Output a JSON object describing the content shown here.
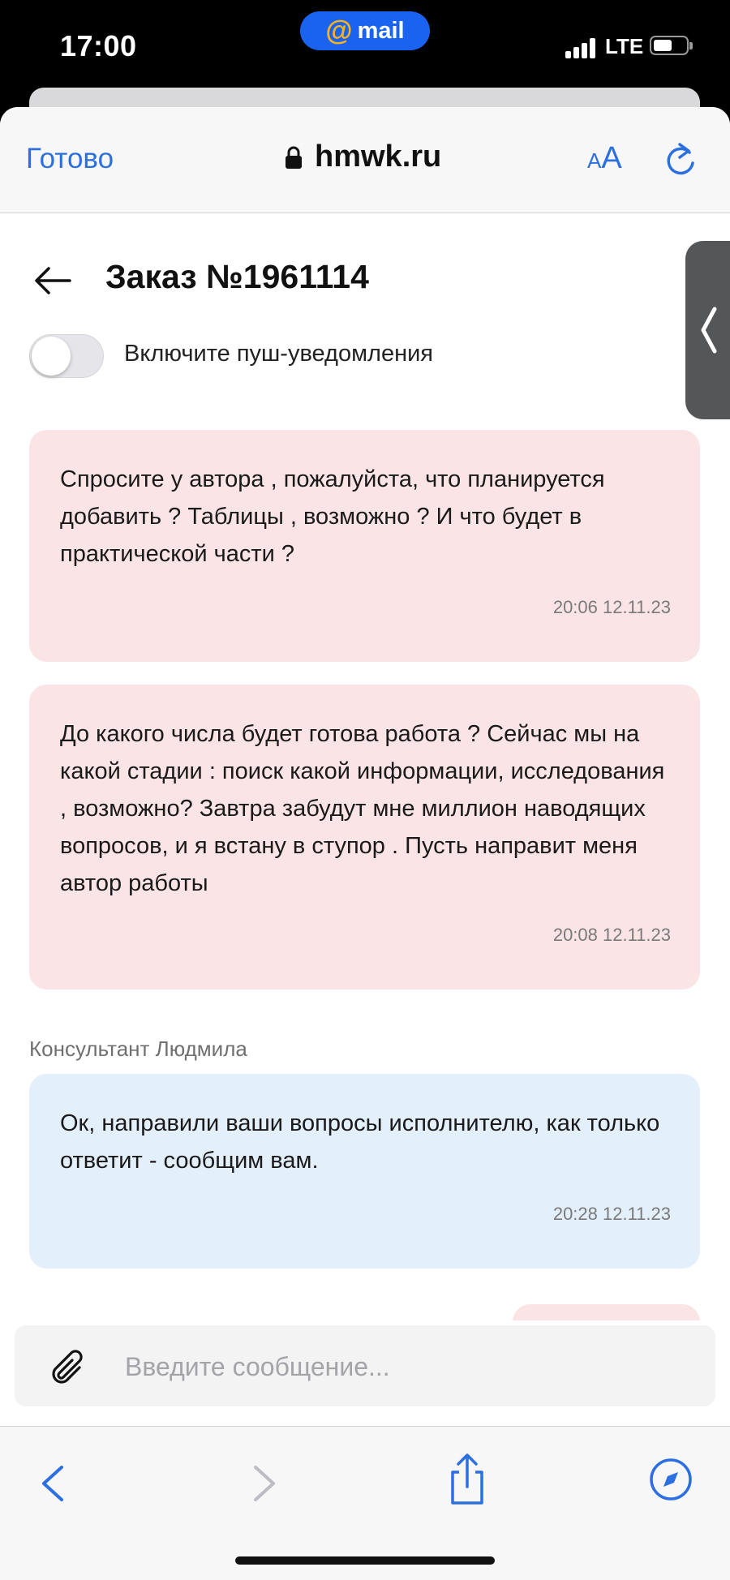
{
  "status": {
    "time": "17:00",
    "island_label": "mail",
    "island_at": "@",
    "network": "LTE"
  },
  "browser": {
    "done_label": "Готово",
    "url": "hmwk.ru",
    "text_size_small": "A",
    "text_size_big": "A"
  },
  "page": {
    "order_title": "Заказ №1961114",
    "push_toggle": {
      "label": "Включите пуш-уведомления",
      "on": false
    }
  },
  "messages": [
    {
      "side": "out",
      "text": "Спросите у автора , пожалуйста, что планируется добавить ? Таблицы , возможно ? И что будет в практической части ?",
      "timestamp": "20:06 12.11.23"
    },
    {
      "side": "out",
      "text": "До какого числа будет готова работа ? Сейчас мы на какой стадии : поиск какой информации, исследования , возможно? Завтра забудут мне миллион наводящих вопросов, и я встану в ступор . Пусть направит меня автор работы",
      "timestamp": "20:08 12.11.23"
    },
    {
      "side": "in",
      "sender": "Консультант Людмила",
      "text": "Ок, направили ваши вопросы исполнителю, как только ответит - сообщим вам.",
      "timestamp": "20:28 12.11.23"
    }
  ],
  "composer": {
    "placeholder": "Введите сообщение...",
    "value": ""
  },
  "colors": {
    "accent": "#2c6fe0",
    "outgoing_bubble": "#fbe4e5",
    "incoming_bubble": "#e4effc",
    "island": "#1a63f0"
  },
  "icons": [
    "lock-icon",
    "reload-icon",
    "back-arrow-icon",
    "paperclip-icon",
    "nav-back-icon",
    "nav-forward-icon",
    "share-icon",
    "compass-icon",
    "chevron-left-icon"
  ]
}
